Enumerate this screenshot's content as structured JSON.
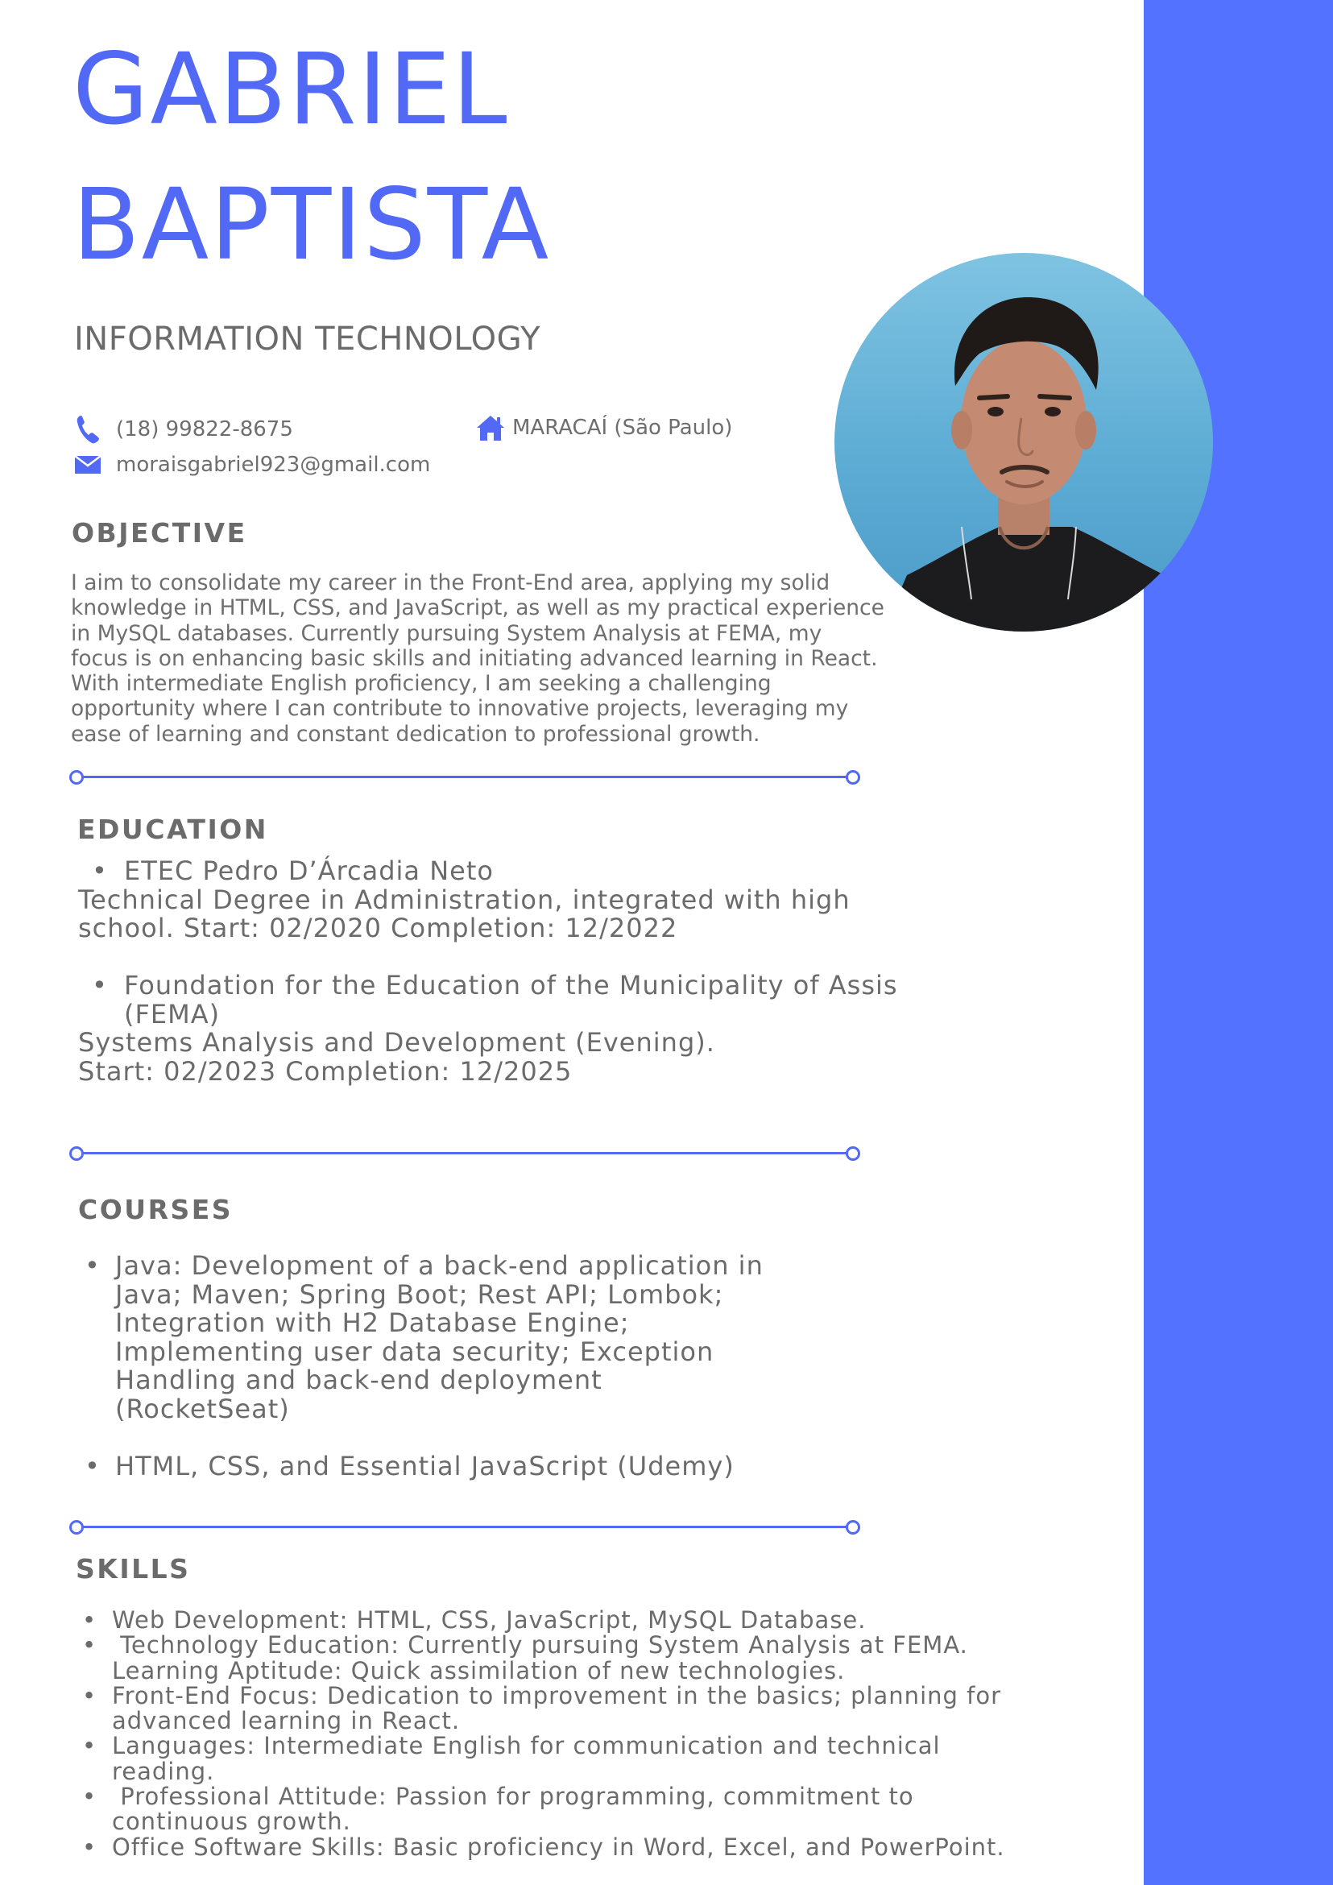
{
  "header": {
    "first_name": "GABRIEL",
    "last_name": "BAPTISTA",
    "title": "INFORMATION TECHNOLOGY"
  },
  "contact": {
    "phone": "(18) 99822-8675",
    "email": "moraisgabriel923@gmail.com",
    "location": "MARACAÍ (São Paulo)",
    "icons": [
      "phone-icon",
      "email-icon",
      "home-icon"
    ]
  },
  "colors": {
    "accent": "#5169f5",
    "sidebar": "#5272ff",
    "text": "#6b6b6b"
  },
  "objective": {
    "heading": "OBJECTIVE",
    "lines": [
      "I aim to consolidate my career in the Front-End area, applying my solid",
      "knowledge in HTML, CSS, and JavaScript, as well as my practical experience",
      "in MySQL databases. Currently pursuing System Analysis at FEMA, my",
      "focus is on enhancing basic skills and initiating advanced learning in React.",
      "With intermediate English proficiency, I am seeking a challenging",
      "opportunity where I can contribute to innovative projects, leveraging my",
      "ease of learning and constant dedication to professional growth."
    ]
  },
  "education": {
    "heading": "EDUCATION",
    "entries": [
      {
        "school_lines": [
          "ETEC Pedro D’Árcadia Neto"
        ],
        "detail_lines": [
          "Technical Degree in Administration, integrated with high",
          "school. Start: 02/2020 Completion: 12/2022"
        ]
      },
      {
        "school_lines": [
          "Foundation for the Education of the Municipality of Assis",
          "(FEMA)"
        ],
        "detail_lines": [
          "Systems Analysis and Development (Evening).",
          "Start: 02/2023 Completion: 12/2025"
        ]
      }
    ]
  },
  "courses": {
    "heading": "COURSES",
    "items": [
      {
        "lines": [
          "Java: Development of a back-end application in",
          "Java; Maven; Spring Boot; Rest API; Lombok;",
          "Integration with H2 Database Engine;",
          "Implementing user data security; Exception",
          "Handling and back-end deployment",
          "(RocketSeat)"
        ]
      },
      {
        "lines": [
          "HTML, CSS, and Essential JavaScript (Udemy)"
        ]
      }
    ]
  },
  "skills": {
    "heading": "SKILLS",
    "items": [
      {
        "lines": [
          "Web Development: HTML, CSS, JavaScript, MySQL Database."
        ]
      },
      {
        "lines": [
          " Technology Education: Currently pursuing System Analysis at FEMA.",
          "Learning Aptitude: Quick assimilation of new technologies."
        ]
      },
      {
        "lines": [
          "Front-End Focus: Dedication to improvement in the basics; planning for",
          "advanced learning in React."
        ]
      },
      {
        "lines": [
          "Languages: Intermediate English for communication and technical",
          "reading."
        ]
      },
      {
        "lines": [
          " Professional Attitude: Passion for programming, commitment to",
          "continuous growth."
        ]
      },
      {
        "lines": [
          "Office Software Skills: Basic proficiency in Word, Excel, and PowerPoint."
        ]
      }
    ]
  }
}
